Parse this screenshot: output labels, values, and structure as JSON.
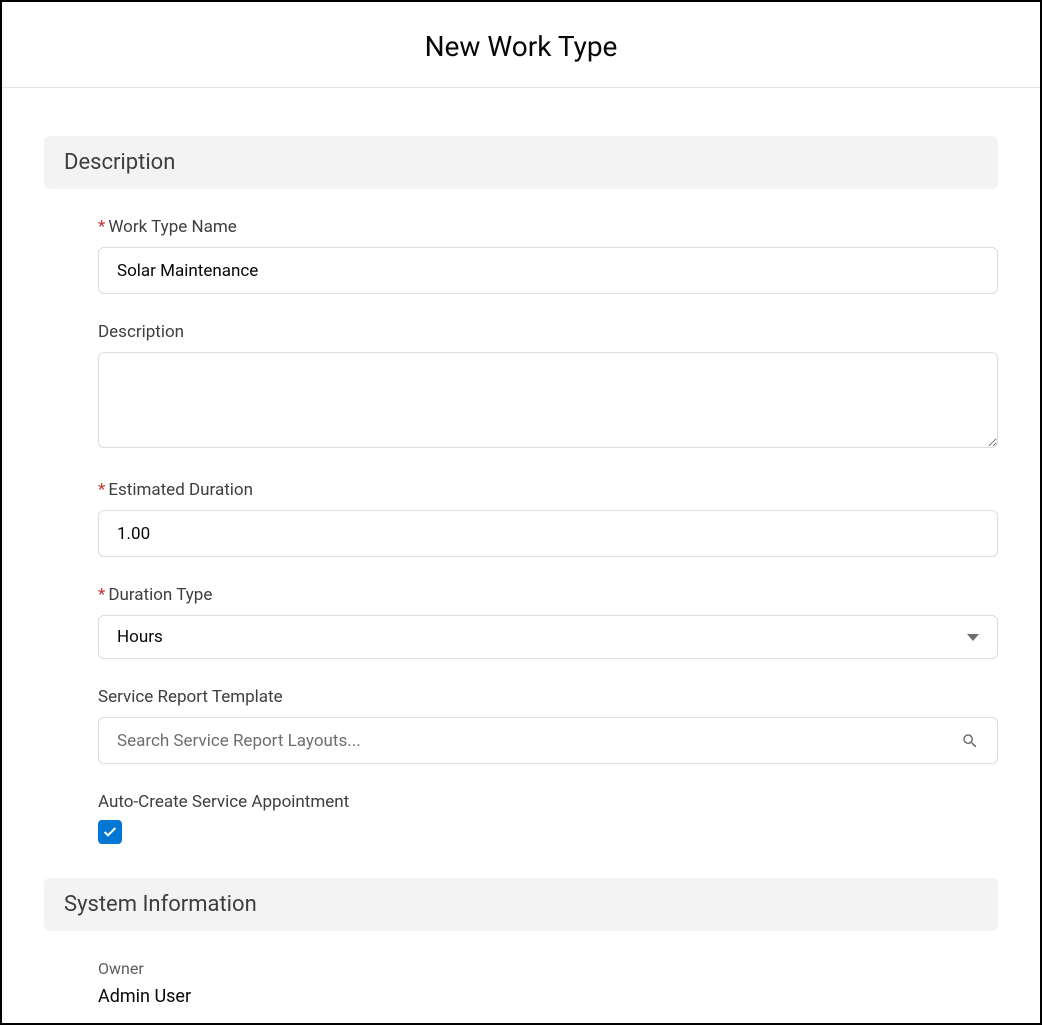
{
  "header": {
    "title": "New Work Type"
  },
  "sections": {
    "description": {
      "title": "Description",
      "fields": {
        "workTypeName": {
          "label": "Work Type Name",
          "required": true,
          "value": "Solar Maintenance"
        },
        "description": {
          "label": "Description",
          "required": false,
          "value": ""
        },
        "estimatedDuration": {
          "label": "Estimated Duration",
          "required": true,
          "value": "1.00"
        },
        "durationType": {
          "label": "Duration Type",
          "required": true,
          "value": "Hours"
        },
        "serviceReportTemplate": {
          "label": "Service Report Template",
          "required": false,
          "placeholder": "Search Service Report Layouts...",
          "value": ""
        },
        "autoCreate": {
          "label": "Auto-Create Service Appointment",
          "checked": true
        }
      }
    },
    "systemInfo": {
      "title": "System Information",
      "fields": {
        "owner": {
          "label": "Owner",
          "value": "Admin User"
        }
      }
    }
  }
}
